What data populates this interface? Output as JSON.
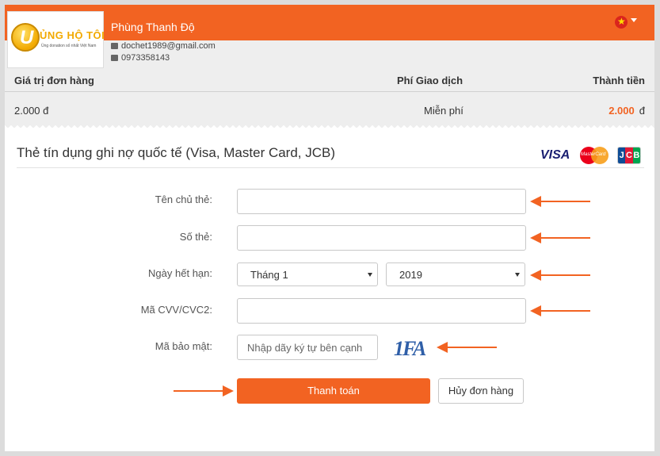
{
  "header": {
    "logo_text": "ỦNG HỘ TÔI",
    "logo_sub": "Ủng donation số nhất Việt Nam",
    "merchant_name": "Phùng Thanh Độ",
    "email": "dochet1989@gmail.com",
    "phone": "0973358143",
    "language_flag": "vn-flag-icon"
  },
  "order": {
    "headers": [
      "Giá trị đơn hàng",
      "Phí Giao dịch",
      "Thành tiền"
    ],
    "amount": "2.000 đ",
    "fee": "Miễn phí",
    "total_value": "2.000",
    "total_unit": "đ"
  },
  "card_form": {
    "title": "Thẻ tín dụng ghi nợ quốc tế (Visa, Master Card, JCB)",
    "brands": [
      "VISA",
      "MasterCard",
      "JCB"
    ],
    "labels": {
      "holder": "Tên chủ thẻ:",
      "number": "Số thẻ:",
      "expiry": "Ngày hết hạn:",
      "cvv": "Mã CVV/CVC2:",
      "captcha": "Mã bảo mật:"
    },
    "expiry_month": "Tháng 1",
    "expiry_year": "2019",
    "captcha_placeholder": "Nhập dãy ký tự bên cạnh",
    "captcha_image_text": "1FA",
    "pay_button": "Thanh toán",
    "cancel_button": "Hủy đơn hàng"
  },
  "colors": {
    "accent": "#f26322",
    "visa": "#1a1f71"
  }
}
